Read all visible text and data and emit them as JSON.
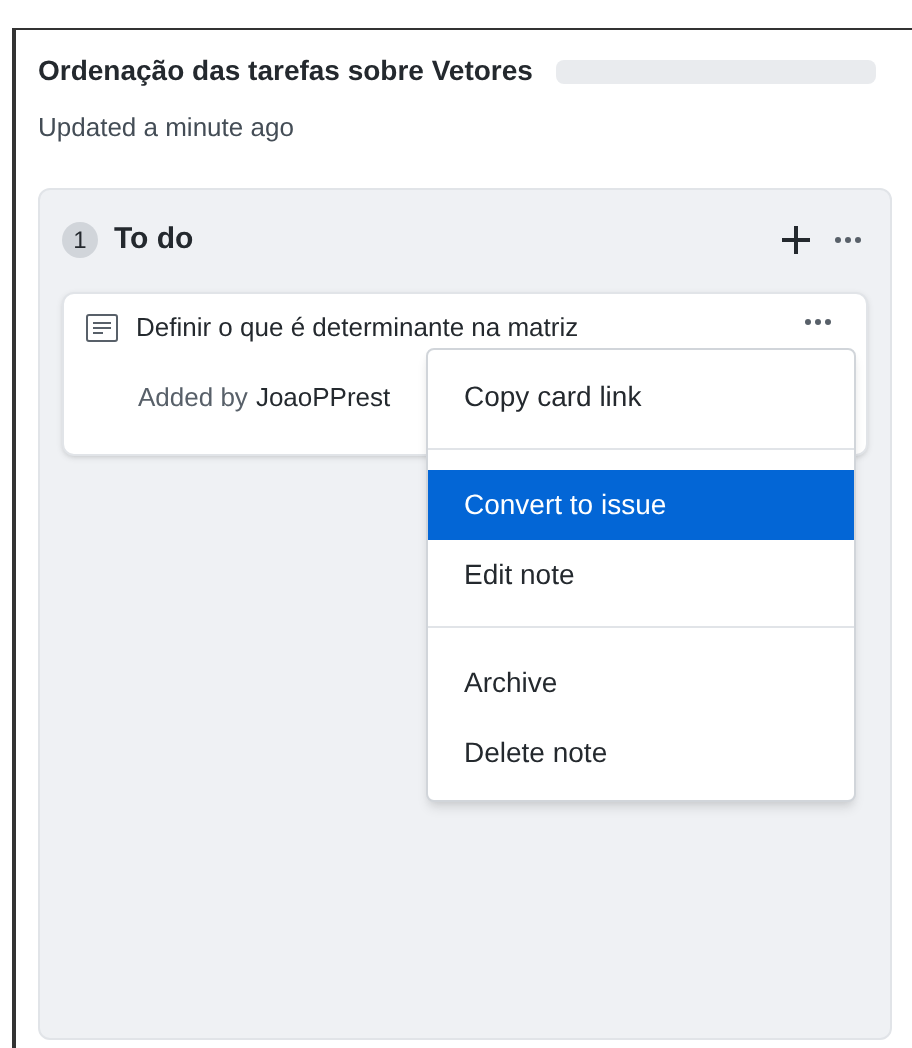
{
  "project": {
    "title": "Ordenação das tarefas sobre Vetores",
    "updated": "Updated a minute ago"
  },
  "column": {
    "count": "1",
    "name": "To do"
  },
  "card": {
    "title": "Definir o que é determinante na matriz",
    "added_by": "Added by",
    "author": "JoaoPPrest"
  },
  "menu": {
    "groups": [
      [
        {
          "label": "Copy card link",
          "selected": false
        }
      ],
      [
        {
          "label": "Convert to issue",
          "selected": true
        },
        {
          "label": "Edit note",
          "selected": false
        }
      ],
      [
        {
          "label": "Archive",
          "selected": false
        },
        {
          "label": "Delete note",
          "selected": false
        }
      ]
    ]
  }
}
